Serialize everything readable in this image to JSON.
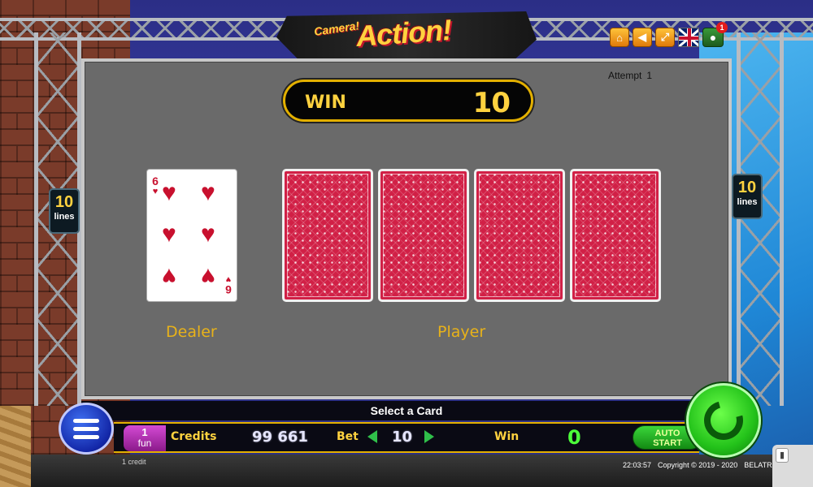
{
  "game": {
    "logo_small": "Camera!",
    "logo_big": "Action!"
  },
  "top_buttons": [
    {
      "name": "home",
      "glyph": "⌂"
    },
    {
      "name": "sound",
      "glyph": "◀"
    },
    {
      "name": "fullscreen",
      "glyph": "⤢"
    }
  ],
  "notification_count": "1",
  "lines": {
    "num": "10",
    "label": "lines"
  },
  "gamble": {
    "attempt_label": "Attempt",
    "attempt_value": "1",
    "win_label": "WIN",
    "win_value": "10",
    "dealer_card": {
      "rank": "6",
      "suit": "♥",
      "suit_color": "#c8102e"
    },
    "player_cards_count": 4,
    "dealer_label": "Dealer",
    "player_label": "Player"
  },
  "status": {
    "message": "Select a Card",
    "fun_count": "1",
    "fun_label": "fun",
    "credits_label": "Credits",
    "credits_value": "99 661",
    "bet_label": "Bet",
    "bet_value": "10",
    "win_label": "Win",
    "win_value": "0",
    "auto_start_line1": "AUTO",
    "auto_start_line2": "START",
    "credit_note": "1 credit",
    "time": "22:03:57",
    "copyright": "Copyright ©  2019 - 2020",
    "brand": "BELATRA"
  },
  "colors": {
    "accent_gold": "#ffd23f",
    "card_back_red": "#d12046",
    "win_green": "#4cff3a"
  }
}
